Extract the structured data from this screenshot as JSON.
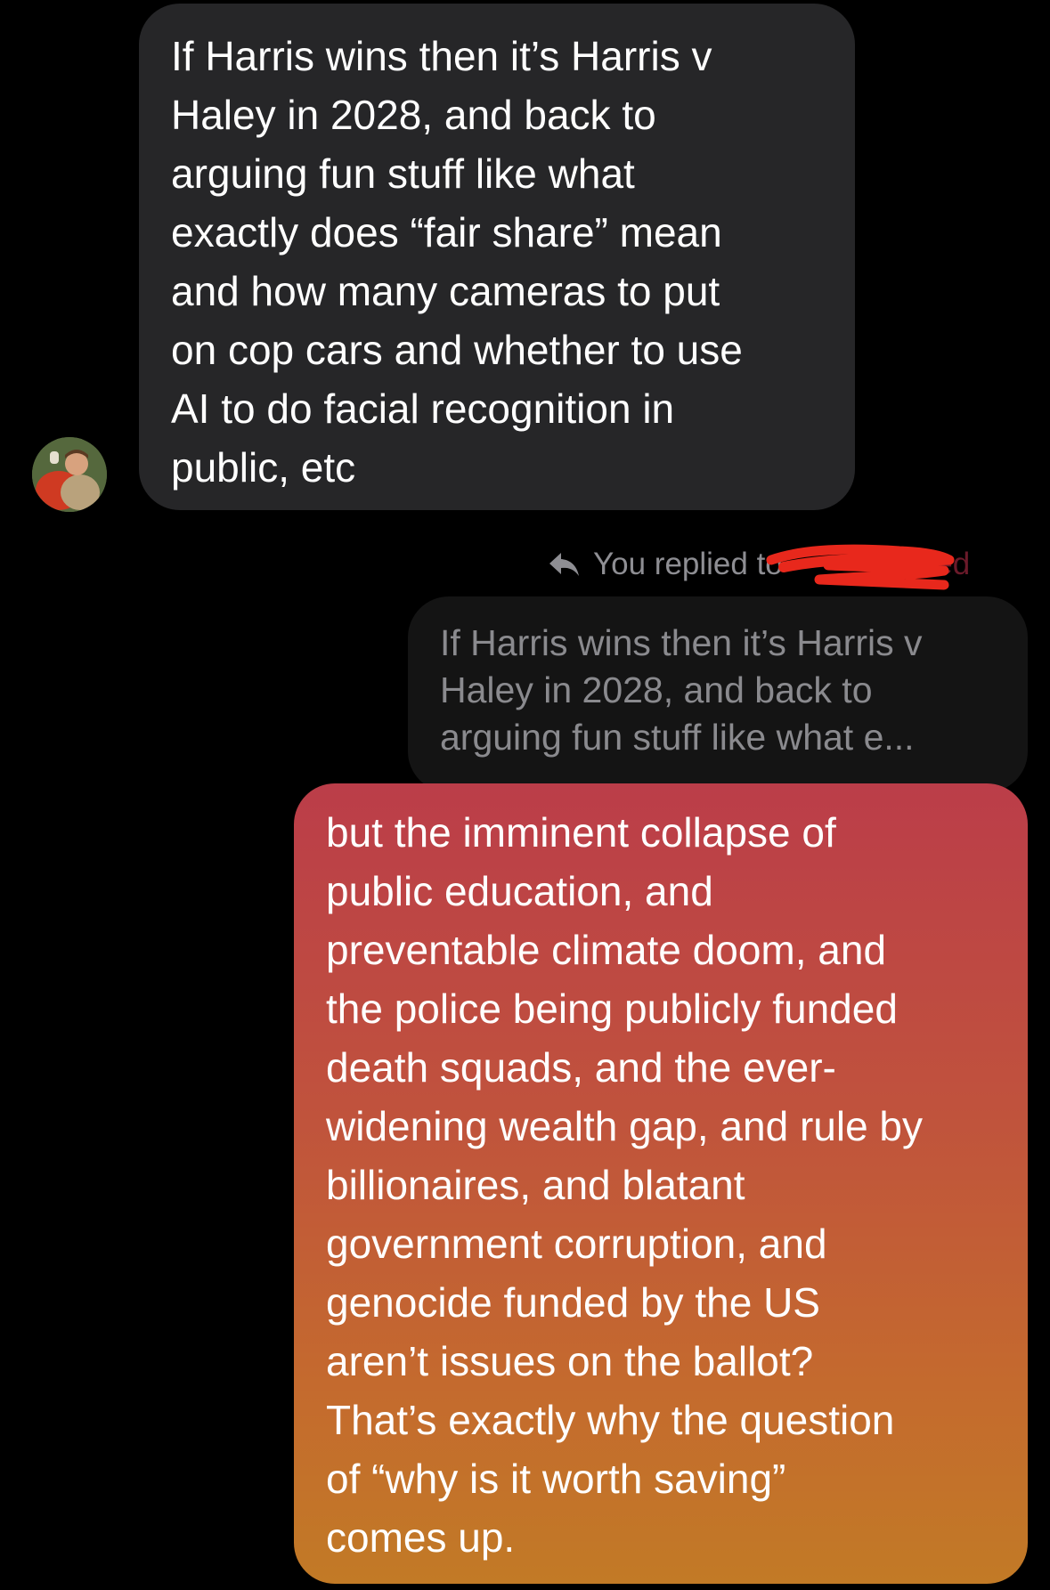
{
  "thread": {
    "received_message": {
      "text": "If Harris wins then it’s Harris v\nHaley in 2028, and back to\narguing fun stuff like what\nexactly does “fair share” mean\nand how many cameras to put\non cop cars and whether to use\nAI to do facial recognition in\npublic, etc",
      "avatar_icon": "contact-avatar"
    },
    "reply_context": {
      "label": "You replied to",
      "recipient_visible_fragment": "ited",
      "icon": "reply-arrow-icon"
    },
    "quoted_message": {
      "text": "If Harris wins then it’s Harris v\nHaley in 2028, and back to\narguing fun stuff like what e..."
    },
    "sent_message": {
      "text": "but the imminent collapse of\npublic education, and\npreventable climate doom, and\nthe police being publicly funded\ndeath squads, and the ever-\nwidening wealth gap, and rule by\nbillionaires, and blatant\ngovernment corruption, and\ngenocide funded by the US\naren’t issues on the ballot?\nThat’s exactly why the question\nof “why is it worth saving”\ncomes up.",
      "gradient_colors": [
        "#bb3d49",
        "#c0523d",
        "#c46a2e",
        "#c27a26"
      ]
    }
  },
  "colors": {
    "background": "#000000",
    "received_bubble": "#262628",
    "quoted_bubble": "#141414",
    "secondary_text": "#8e8e93",
    "redaction": "#e8281c"
  }
}
